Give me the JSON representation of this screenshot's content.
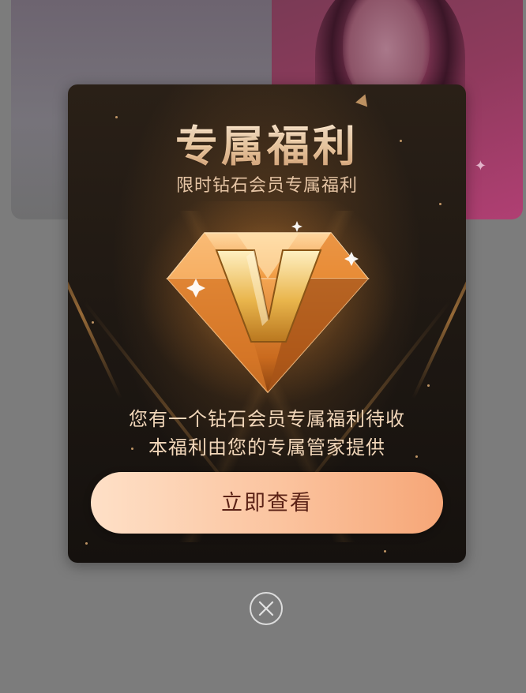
{
  "modal": {
    "title": "专属福利",
    "subtitle": "限时钻石会员专属福利",
    "badge_letter": "V",
    "message_line_1": "您有一个钻石会员专属福利待收",
    "message_line_2": "本福利由您的专属管家提供",
    "cta_label": "立即查看"
  },
  "icons": {
    "diamond": "diamond-v-icon",
    "close": "close-icon",
    "sparkle": "sparkle-icon"
  },
  "colors": {
    "modal_bg": "#1d1712",
    "title_gold": "#f2cfa7",
    "button_gradient_start": "#fee0c7",
    "button_gradient_end": "#f6a677",
    "button_text": "#5b2216",
    "overlay": "#7c7c7c"
  }
}
